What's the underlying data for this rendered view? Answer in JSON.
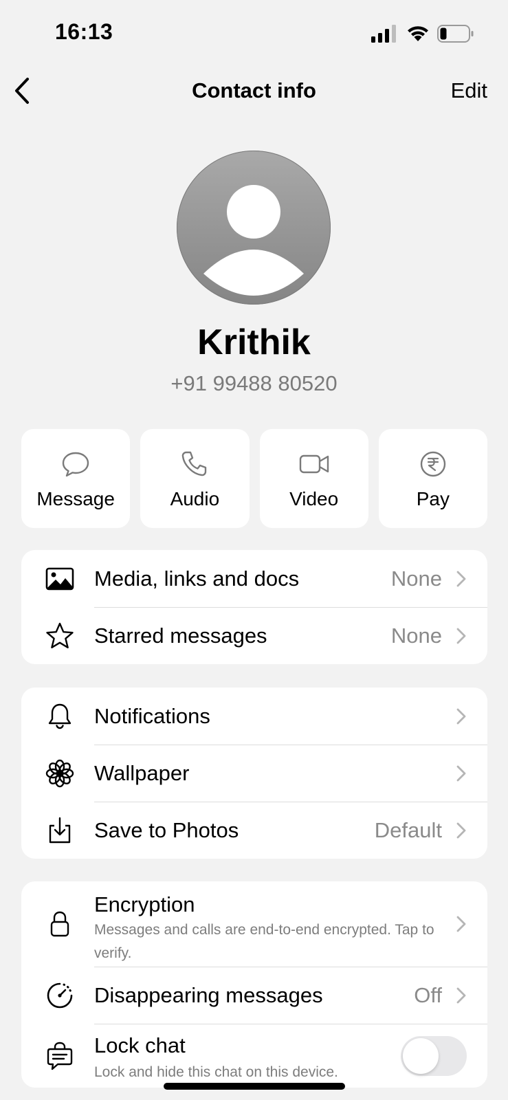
{
  "status_bar": {
    "time": "16:13"
  },
  "nav": {
    "back_icon": "chevron-left-icon",
    "title": "Contact info",
    "edit_label": "Edit"
  },
  "contact": {
    "name": "Krithik",
    "phone": "+91 99488 80520"
  },
  "actions": [
    {
      "label": "Message",
      "icon": "message-bubble-icon"
    },
    {
      "label": "Audio",
      "icon": "phone-icon"
    },
    {
      "label": "Video",
      "icon": "video-camera-icon"
    },
    {
      "label": "Pay",
      "icon": "rupee-icon"
    }
  ],
  "media_section": {
    "media": {
      "label": "Media, links and docs",
      "value": "None",
      "icon": "image-icon"
    },
    "starred": {
      "label": "Starred messages",
      "value": "None",
      "icon": "star-icon"
    }
  },
  "settings_section": {
    "notifications": {
      "label": "Notifications",
      "icon": "bell-icon"
    },
    "wallpaper": {
      "label": "Wallpaper",
      "icon": "flower-icon"
    },
    "save_to_photos": {
      "label": "Save to Photos",
      "value": "Default",
      "icon": "download-icon"
    }
  },
  "privacy_section": {
    "encryption": {
      "label": "Encryption",
      "subtitle": "Messages and calls are end-to-end encrypted. Tap to verify.",
      "icon": "lock-icon"
    },
    "disappearing": {
      "label": "Disappearing messages",
      "value": "Off",
      "icon": "timer-icon"
    },
    "lock_chat": {
      "label": "Lock chat",
      "subtitle": "Lock and hide this chat on this device.",
      "icon": "chat-lock-icon",
      "enabled": false
    }
  },
  "colors": {
    "background": "#f2f2f2",
    "card": "#ffffff",
    "secondary_text": "#8a8a8a",
    "toggle_off": "#e8e8ea"
  }
}
